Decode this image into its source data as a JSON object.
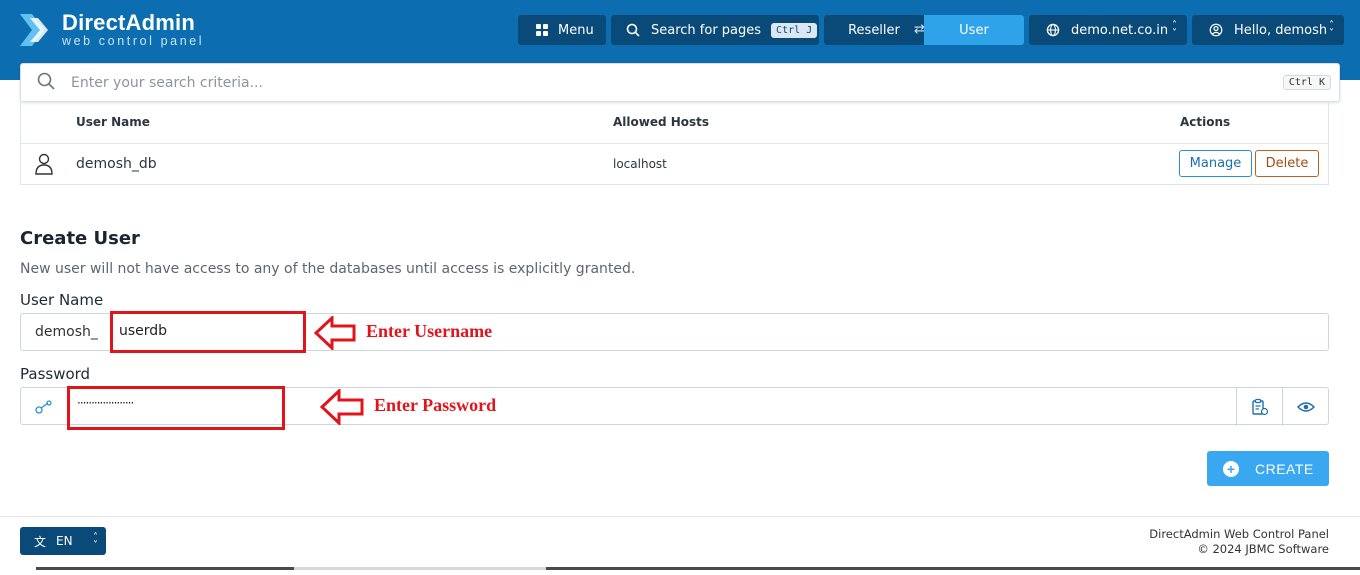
{
  "header": {
    "logo_name": "DirectAdmin",
    "logo_sub": "web control panel",
    "menu_label": "Menu",
    "search_label": "Search for pages",
    "search_shortcut": "Ctrl J",
    "reseller_label": "Reseller",
    "user_label": "User",
    "domain_label": "demo.net.co.in",
    "hello_label": "Hello, demosh"
  },
  "global_search": {
    "placeholder": "Enter your search criteria...",
    "shortcut": "Ctrl K"
  },
  "table": {
    "columns": [
      "User Name",
      "Allowed Hosts",
      "Actions"
    ],
    "rows": [
      {
        "user_name": "demosh_db",
        "allowed_hosts": "localhost",
        "manage_label": "Manage",
        "delete_label": "Delete"
      }
    ]
  },
  "create_user": {
    "title": "Create User",
    "description": "New user will not have access to any of the databases until access is explicitly granted.",
    "username_label": "User Name",
    "username_prefix": "demosh_",
    "username_value": "userdb",
    "password_label": "Password",
    "password_value": "····················",
    "create_label": "CREATE"
  },
  "annotations": {
    "username_hint": "Enter Username",
    "password_hint": "Enter Password"
  },
  "footer": {
    "lang_label": "EN",
    "line1": "DirectAdmin Web Control Panel",
    "line2": "© 2024 JBMC Software"
  },
  "colors": {
    "header_bg": "#0c6eb0",
    "button_dark": "#0a4a78",
    "accent": "#3aa8f0",
    "annotation_red": "#e0141b"
  }
}
